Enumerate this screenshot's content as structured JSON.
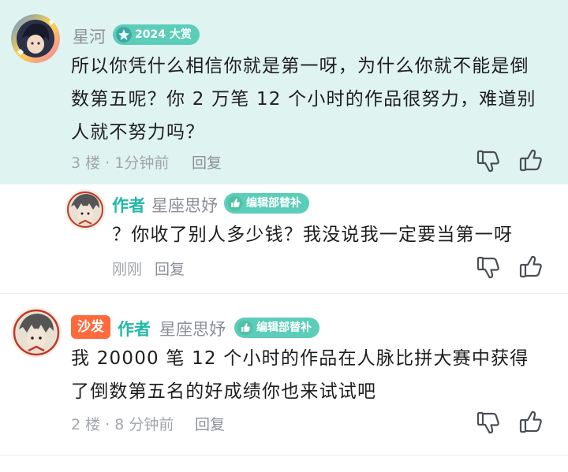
{
  "comments": [
    {
      "username": "星河",
      "badge": "2024 大赏",
      "text": "所以你凭什么相信你就是第一呀，为什么你就不能是倒数第五呢？你 2 万笔 12 个小时的作品很努力，难道别人就不努力吗？",
      "floor": "3 楼",
      "time": "1分钟前",
      "reply": "回复"
    },
    {
      "author_tag": "作者",
      "username": "星座思妤",
      "badge": "编辑部替补",
      "text": "？你收了别人多少钱？我没说我一定要当第一呀",
      "time": "刚刚",
      "reply": "回复"
    },
    {
      "sofa": "沙发",
      "author_tag": "作者",
      "username": "星座思妤",
      "badge": "编辑部替补",
      "text": "我 20000 笔 12 个小时的作品在人脉比拼大赛中获得了倒数第五名的好成绩你也来试试吧",
      "floor": "2 楼",
      "time": "8 分钟前",
      "reply": "回复"
    }
  ],
  "meta_separator": " · ",
  "colors": {
    "highlight_bg": "#dff3f1",
    "accent": "#21b8a6",
    "badge": "#5bcdb9",
    "sofa": "#ff6a3d"
  },
  "icons": [
    "thumbs-down-icon",
    "thumbs-up-icon",
    "badge-star-icon",
    "badge-thumb-icon"
  ]
}
